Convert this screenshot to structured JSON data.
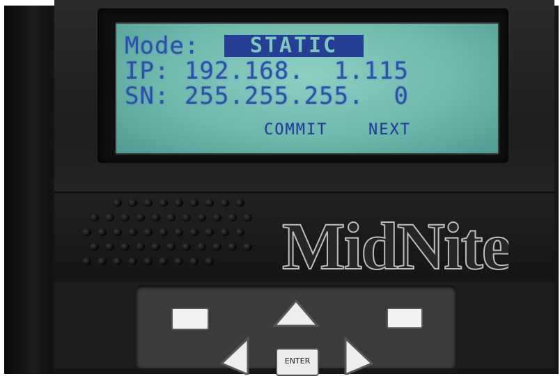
{
  "lcd": {
    "mode_label": "Mode:",
    "mode_value": "STATIC",
    "ip_row": "IP: 192.168.  1.115",
    "sn_row": "SN: 255.255.255.  0",
    "softkey_commit": "COMMIT",
    "softkey_next": "NEXT"
  },
  "device": {
    "brand": "MidNite",
    "enter_label": "ENTER"
  },
  "colors": {
    "lcd_background": "#7fc5b9",
    "lcd_text": "#2c52a8",
    "housing": "#1b1b1b"
  },
  "icons": [
    "speaker-grille-icon",
    "up-arrow-icon",
    "left-arrow-icon",
    "right-arrow-icon"
  ]
}
